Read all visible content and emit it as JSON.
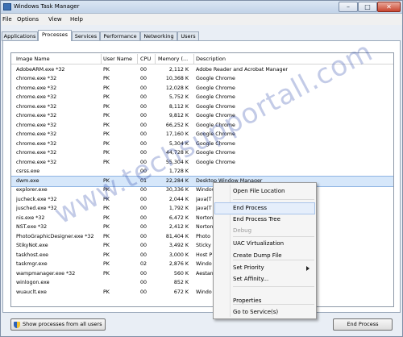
{
  "window": {
    "title": "Windows Task Manager"
  },
  "menu": [
    "File",
    "Options",
    "View",
    "Help"
  ],
  "tabs": [
    "Applications",
    "Processes",
    "Services",
    "Performance",
    "Networking",
    "Users"
  ],
  "columns": [
    "Image Name",
    "User Name",
    "CPU",
    "Memory (...",
    "Description"
  ],
  "rows": [
    [
      "AdobeARM.exe *32",
      "PK",
      "00",
      "2,112 K",
      "Adobe Reader and Acrobat Manager"
    ],
    [
      "chrome.exe *32",
      "PK",
      "00",
      "10,368 K",
      "Google Chrome"
    ],
    [
      "chrome.exe *32",
      "PK",
      "00",
      "12,028 K",
      "Google Chrome"
    ],
    [
      "chrome.exe *32",
      "PK",
      "00",
      "5,752 K",
      "Google Chrome"
    ],
    [
      "chrome.exe *32",
      "PK",
      "00",
      "8,112 K",
      "Google Chrome"
    ],
    [
      "chrome.exe *32",
      "PK",
      "00",
      "9,812 K",
      "Google Chrome"
    ],
    [
      "chrome.exe *32",
      "PK",
      "00",
      "66,252 K",
      "Google Chrome"
    ],
    [
      "chrome.exe *32",
      "PK",
      "00",
      "17,160 K",
      "Google Chrome"
    ],
    [
      "chrome.exe *32",
      "PK",
      "00",
      "5,304 K",
      "Google Chrome"
    ],
    [
      "chrome.exe *32",
      "PK",
      "00",
      "44,728 K",
      "Google Chrome"
    ],
    [
      "chrome.exe *32",
      "PK",
      "00",
      "55,304 K",
      "Google Chrome"
    ],
    [
      "csrss.exe",
      "",
      "00",
      "1,728 K",
      ""
    ],
    [
      "dwm.exe",
      "PK",
      "01",
      "22,284 K",
      "Desktop Window Manager"
    ],
    [
      "explorer.exe",
      "PK",
      "00",
      "30,336 K",
      "Windows"
    ],
    [
      "jucheck.exe *32",
      "PK",
      "00",
      "2,044 K",
      "Java(T"
    ],
    [
      "jusched.exe *32",
      "PK",
      "00",
      "1,792 K",
      "Java(T"
    ],
    [
      "nis.exe *32",
      "PK",
      "00",
      "6,472 K",
      "Norton"
    ],
    [
      "NST.exe *32",
      "PK",
      "00",
      "2,412 K",
      "Norton"
    ],
    [
      "PhotoGraphicDesigner.exe *32",
      "PK",
      "00",
      "81,404 K",
      "Photo"
    ],
    [
      "StikyNot.exe",
      "PK",
      "00",
      "3,492 K",
      "Sticky"
    ],
    [
      "taskhost.exe",
      "PK",
      "00",
      "3,000 K",
      "Host P"
    ],
    [
      "taskmgr.exe",
      "PK",
      "02",
      "2,876 K",
      "Windo"
    ],
    [
      "wampmanager.exe *32",
      "PK",
      "00",
      "560 K",
      "Aestan"
    ],
    [
      "winlogon.exe",
      "",
      "00",
      "852 K",
      ""
    ],
    [
      "wuauclt.exe",
      "PK",
      "00",
      "672 K",
      "Windo"
    ]
  ],
  "selected_row": 12,
  "context_menu": {
    "items": [
      {
        "label": "Open File Location",
        "disabled": false,
        "submenu": false
      },
      {
        "label": "End Process",
        "disabled": false,
        "submenu": false
      },
      {
        "label": "End Process Tree",
        "disabled": false,
        "submenu": false
      },
      {
        "label": "Debug",
        "disabled": true,
        "submenu": false
      },
      {
        "label": "UAC Virtualization",
        "disabled": false,
        "submenu": false
      },
      {
        "label": "Create Dump File",
        "disabled": false,
        "submenu": false
      },
      {
        "label": "Set Priority",
        "disabled": false,
        "submenu": true
      },
      {
        "label": "Set Affinity...",
        "disabled": false,
        "submenu": false
      },
      {
        "label": "Properties",
        "disabled": false,
        "submenu": false
      },
      {
        "label": "Go to Service(s)",
        "disabled": false,
        "submenu": false
      }
    ]
  },
  "buttons": {
    "show_all": "Show processes from all users",
    "end_process": "End Process"
  },
  "watermark": "www.techsupportall.com",
  "colors": {
    "selection": "#d6e7fa",
    "close": "#c8452f"
  }
}
